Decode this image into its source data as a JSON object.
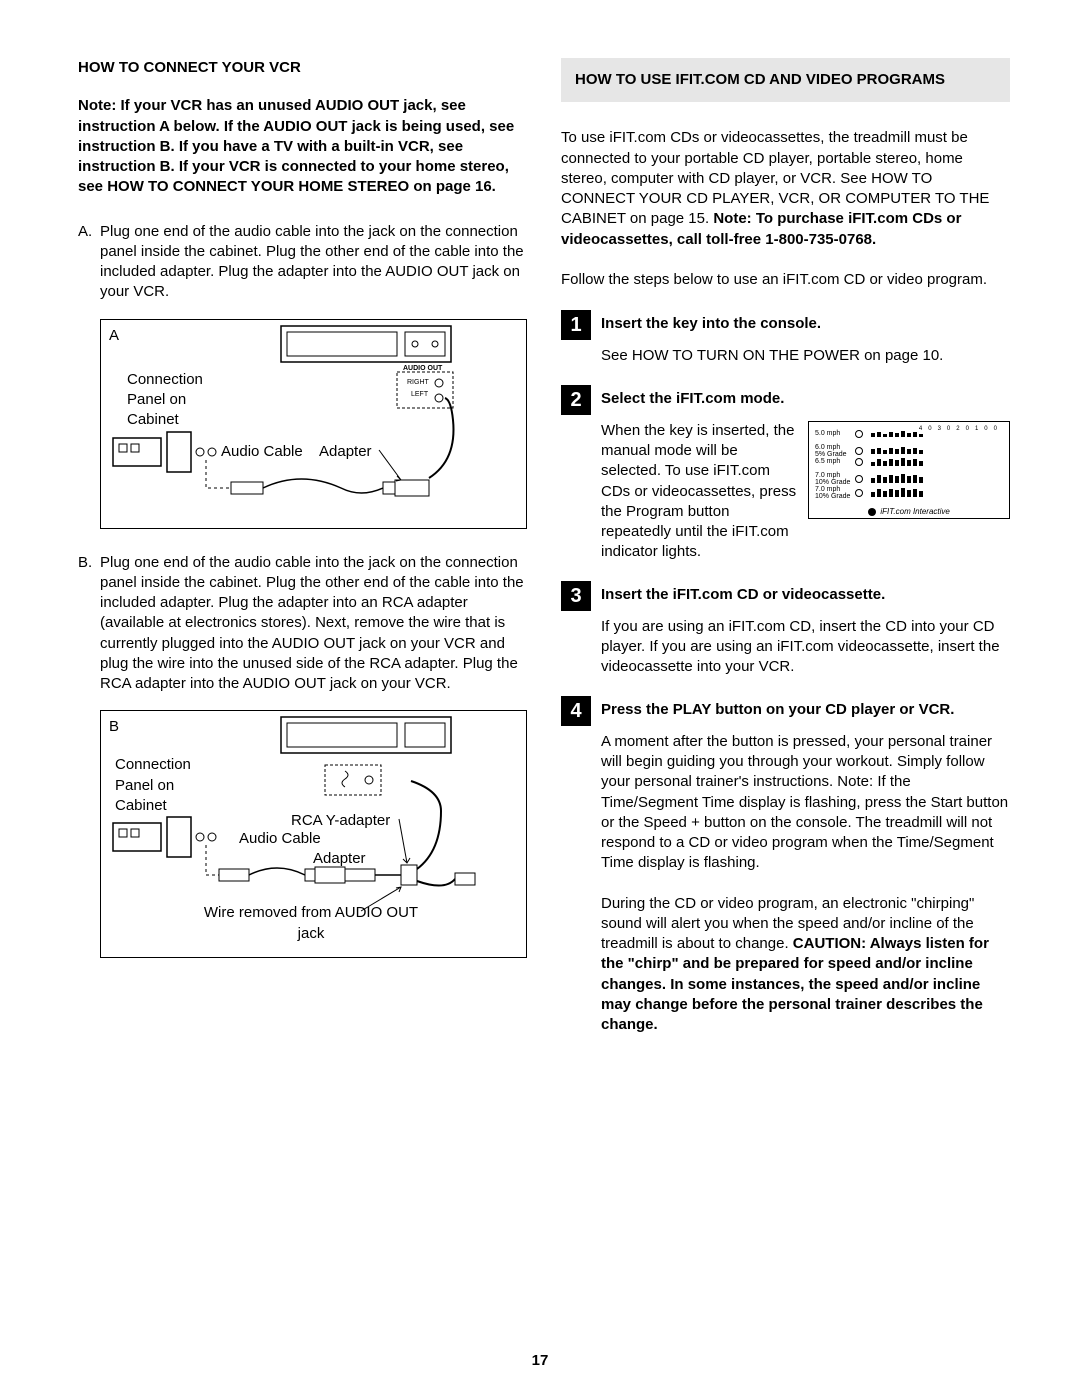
{
  "page_number": "17",
  "left": {
    "heading": "HOW TO CONNECT YOUR VCR",
    "note": "Note: If your VCR has an unused AUDIO OUT jack, see instruction A below. If the AUDIO OUT jack is being used, see instruction B. If you have a TV with a built-in VCR, see instruction B. If your VCR is connected to your home stereo, see HOW TO CONNECT YOUR HOME STEREO on page 16.",
    "item_a_letter": "A.",
    "item_a_text": "Plug one end of the audio cable into the jack on the connection panel inside the cabinet. Plug the other end of the cable into the included adapter. Plug the adapter into the AUDIO OUT jack on your VCR.",
    "diagA_letter": "A",
    "diagA_conn_label": "Connection Panel on Cabinet",
    "diagA_audio_cable": "Audio Cable",
    "diagA_adapter": "Adapter",
    "diagA_audioout": "AUDIO OUT",
    "diagA_right": "RIGHT",
    "diagA_left": "LEFT",
    "item_b_letter": "B.",
    "item_b_text": "Plug one end of the audio cable into the jack on the connection panel inside the cabinet. Plug the other end of the cable into the included adapter. Plug the adapter into an RCA adapter (available at electronics stores). Next, remove the wire that is currently plugged into the AUDIO OUT jack on your VCR and plug the wire into the unused side of the RCA adapter. Plug the RCA adapter into the AUDIO OUT jack on your VCR.",
    "diagB_letter": "B",
    "diagB_conn_label": "Connection Panel on Cabinet",
    "diagB_audio_cable": "Audio Cable",
    "diagB_adapter": "Adapter",
    "diagB_rca": "RCA Y-adapter",
    "diagB_wire": "Wire removed from AUDIO OUT jack"
  },
  "right": {
    "heading": "HOW TO USE IFIT.COM CD AND VIDEO PROGRAMS",
    "intro": "To use iFIT.com CDs or videocassettes, the treadmill must be connected to your portable CD player, portable stereo, home stereo, computer with CD player, or VCR. See HOW TO CONNECT YOUR CD PLAYER, VCR, OR COMPUTER TO THE CABINET on page 15. ",
    "intro_bold": "Note: To purchase iFIT.com CDs or videocassettes, call toll-free 1-800-735-0768.",
    "follow": "Follow the steps below to use an iFIT.com CD or video program.",
    "step1_title": "Insert the key into the console.",
    "step1_body": "See HOW TO TURN ON THE POWER on page 10.",
    "step2_title": "Select the iFIT.com mode.",
    "step2_body": "When the key is inserted, the manual mode will be selected. To use iFIT.com CDs or videocassettes, press the Program button repeatedly until the iFIT.com indicator lights.",
    "step2_diag": {
      "rows": [
        "5.0 mph",
        "6.0 mph 5% Grade",
        "6.5 mph",
        "7.0 mph 10% Grade",
        "7.0 mph 10% Grade"
      ],
      "topscale": [
        "40",
        "30",
        "20",
        "10",
        "0"
      ],
      "footer": "iFIT.com Interactive"
    },
    "step3_title": "Insert the iFIT.com CD or videocassette.",
    "step3_body": "If you are using an iFIT.com CD, insert the CD into your CD player. If you are using an iFIT.com videocassette, insert the videocassette into your VCR.",
    "step4_title": "Press the PLAY button on your CD player or VCR.",
    "step4_body1": "A moment after the button is pressed, your personal trainer will begin guiding you through your workout. Simply follow your personal trainer's instructions. Note: If the Time/Segment Time display is flashing, press the Start button or the Speed + button on the console. The treadmill will not respond to a CD or video program when the Time/Segment Time display is flashing.",
    "step4_body2_plain": "During the CD or video program, an electronic \"chirping\" sound will alert you when the speed and/or incline of the treadmill is about to change. ",
    "step4_body2_bold": "CAUTION: Always listen for the \"chirp\" and be prepared for speed and/or incline changes. In some instances, the speed and/or incline may change before the personal trainer describes the change.",
    "num1": "1",
    "num2": "2",
    "num3": "3",
    "num4": "4"
  }
}
